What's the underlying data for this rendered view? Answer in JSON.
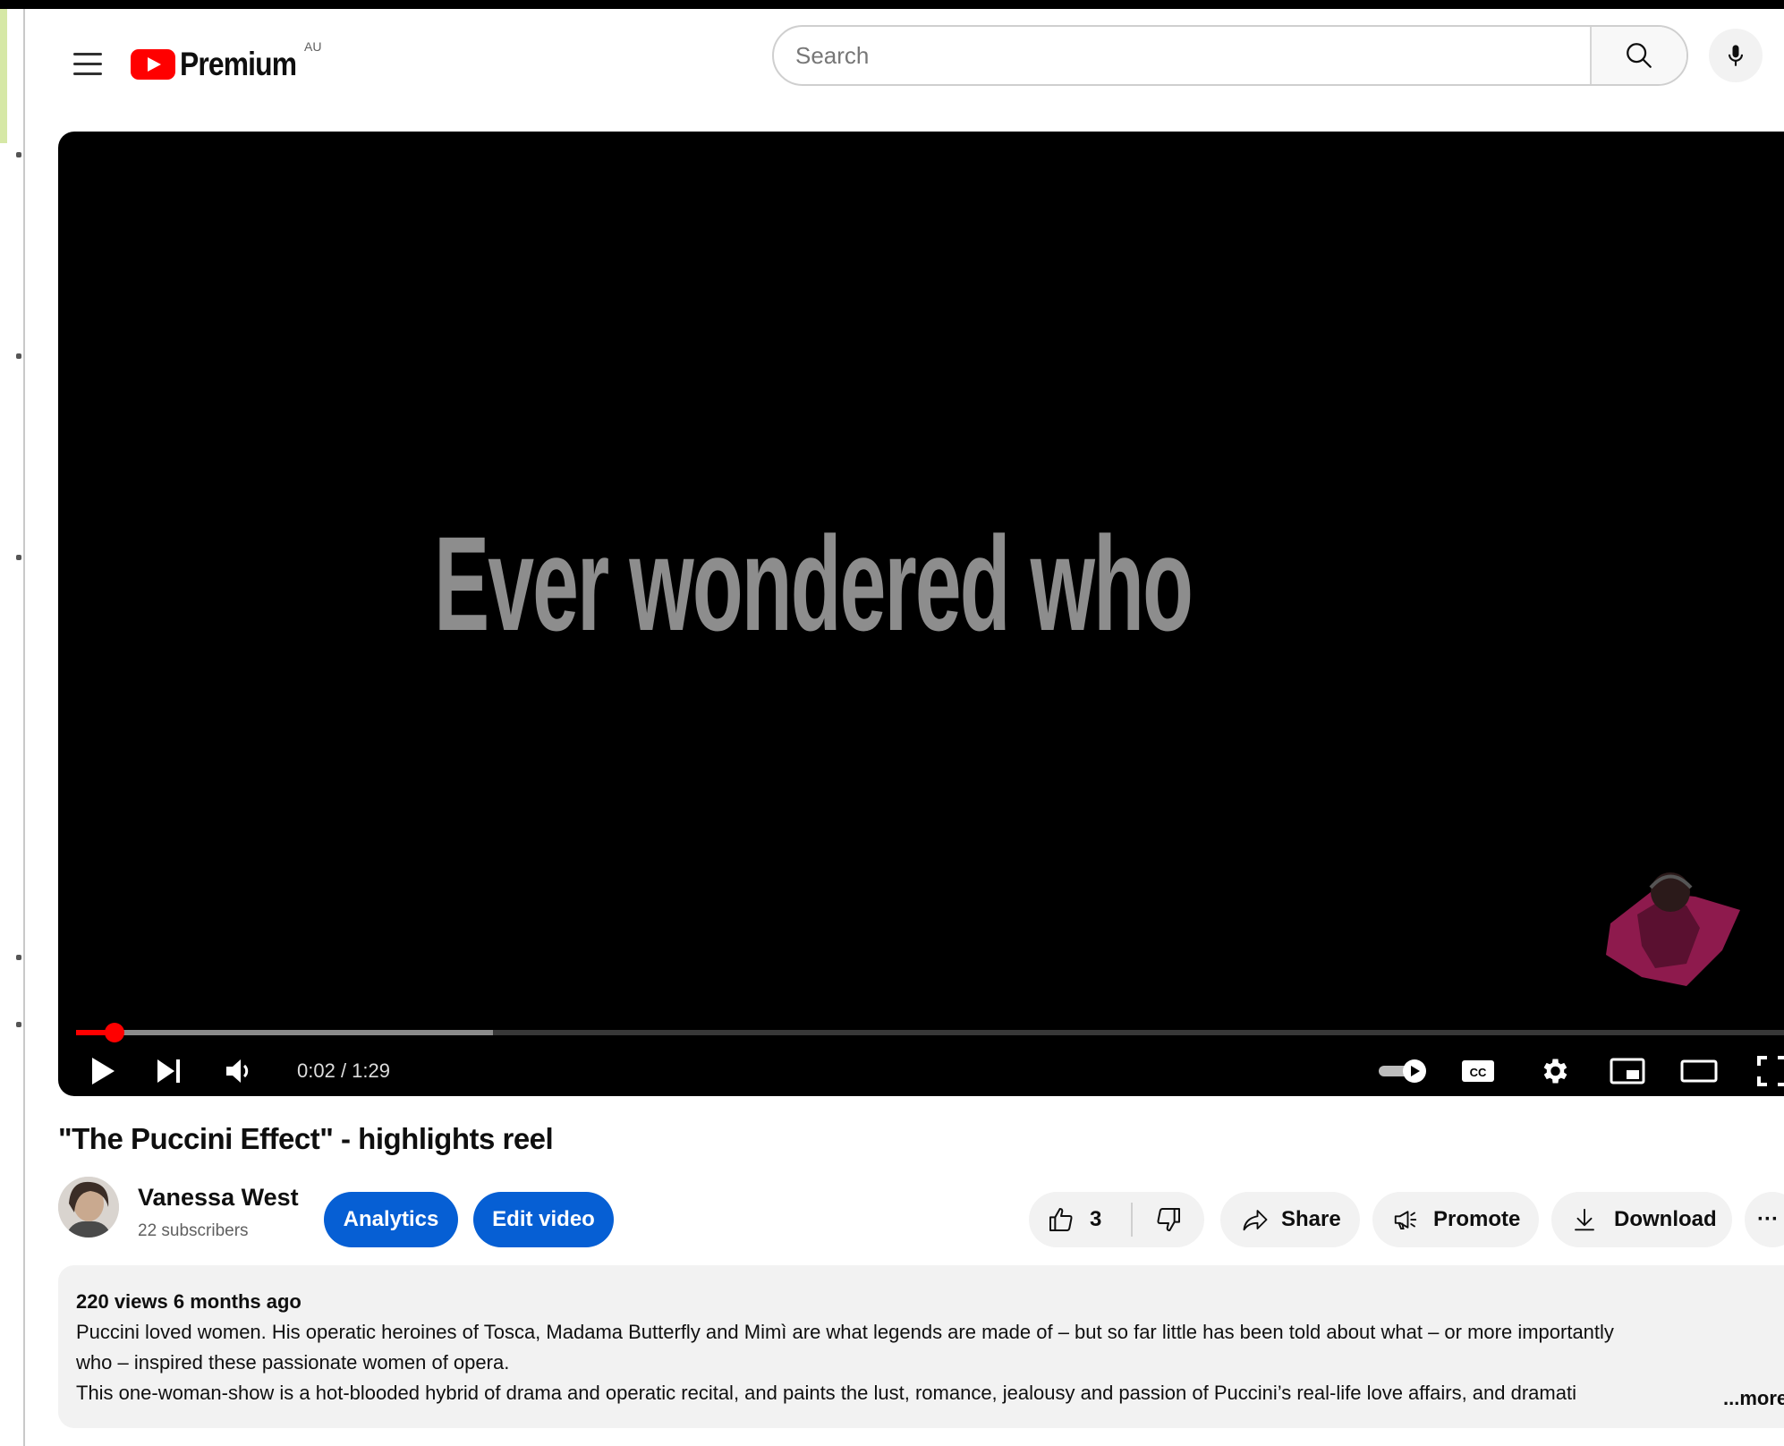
{
  "masthead": {
    "logo_text": "Premium",
    "logo_region": "AU",
    "search_placeholder": "Search"
  },
  "player": {
    "caption": "Ever wondered who",
    "time_current": "0:02",
    "time_separator": " / ",
    "time_total": "1:29",
    "progress_played_fraction": 0.022,
    "progress_buffered_fraction": 0.24
  },
  "video": {
    "title": "\"The Puccini Effect\" - highlights reel"
  },
  "channel": {
    "name": "Vanessa West",
    "subscribers": "22 subscribers"
  },
  "actions": {
    "analytics": "Analytics",
    "edit_video": "Edit video",
    "like_count": "3",
    "share": "Share",
    "promote": "Promote",
    "download": "Download",
    "more": "···"
  },
  "description": {
    "meta": "220 views  6 months ago",
    "line1": "Puccini loved women. His operatic heroines of Tosca, Madama Butterfly and Mimì are what legends are made of – but so far little has been told about what – or more importantly",
    "line2": "who – inspired these passionate women of opera.",
    "line3": "This one-woman-show is a hot-blooded hybrid of drama and operatic recital, and paints the lust, romance, jealousy and passion of Puccini’s real-life love affairs, and dramati",
    "more_label": "...more"
  },
  "colors": {
    "brand_red": "#ff0000",
    "accent_blue": "#065fd4"
  }
}
